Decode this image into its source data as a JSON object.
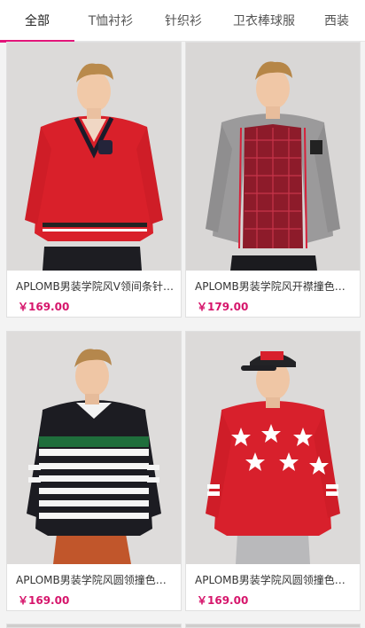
{
  "tabs": [
    {
      "label": "全部",
      "active": true
    },
    {
      "label": "T恤衬衫",
      "active": false
    },
    {
      "label": "针织衫",
      "active": false
    },
    {
      "label": "卫衣棒球服",
      "active": false
    },
    {
      "label": "西装",
      "active": false
    }
  ],
  "products": [
    {
      "title": "APLOMB男装学院风V领间条针织衫",
      "price": "￥169.00",
      "image": "red-v-neck-sweater"
    },
    {
      "title": "APLOMB男装学院风开襟撞色针织开衫",
      "price": "￥179.00",
      "image": "grey-cardigan"
    },
    {
      "title": "APLOMB男装学院风圆领撞色条纹毛衣",
      "price": "￥169.00",
      "image": "striped-crew-sweater"
    },
    {
      "title": "APLOMB男装学院风圆领撞色星星毛衣",
      "price": "￥169.00",
      "image": "red-star-sweater"
    }
  ],
  "colors": {
    "accent": "#e3157a",
    "price": "#d6156b"
  }
}
